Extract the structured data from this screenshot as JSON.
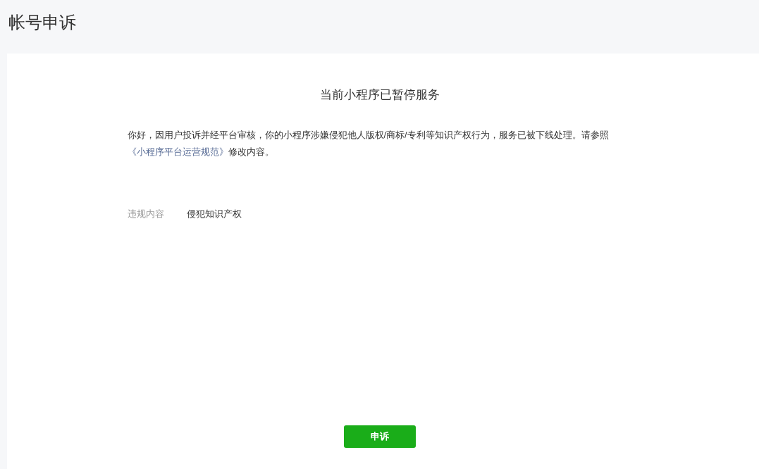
{
  "page_title": "帐号申诉",
  "notice": {
    "heading": "当前小程序已暂停服务",
    "text_before": "你好，因用户投诉并经平台审核，你的小程序涉嫌侵犯他人版权/商标/专利等知识产权行为，服务已被下线处理。请参照",
    "link": "《小程序平台运营规范》",
    "text_after": "修改内容。"
  },
  "details": [
    {
      "label": "违规内容",
      "value": "侵犯知识产权"
    }
  ],
  "buttons": [
    "申诉"
  ]
}
